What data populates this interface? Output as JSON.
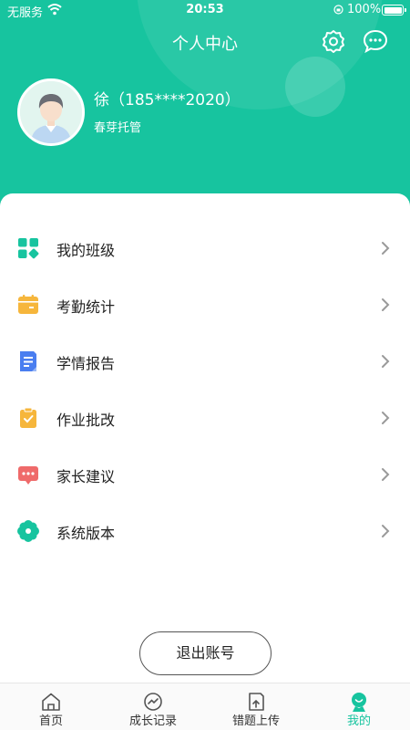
{
  "status_bar": {
    "carrier": "无服务",
    "time": "20:53",
    "battery": "100%"
  },
  "header": {
    "title": "个人中心",
    "settings_icon": "gear-icon",
    "message_icon": "chat-bubble-icon"
  },
  "user": {
    "name": "徐（185****2020）",
    "org": "春芽托管"
  },
  "menu": [
    {
      "label": "我的班级",
      "icon": "grid-icon",
      "color": "#17c49f"
    },
    {
      "label": "考勤统计",
      "icon": "calendar-icon",
      "color": "#f6b63c"
    },
    {
      "label": "学情报告",
      "icon": "report-icon",
      "color": "#4a7ef0"
    },
    {
      "label": "作业批改",
      "icon": "clipboard-check-icon",
      "color": "#f6b63c"
    },
    {
      "label": "家长建议",
      "icon": "comment-icon",
      "color": "#ef6a6a"
    },
    {
      "label": "系统版本",
      "icon": "flower-icon",
      "color": "#17c49f"
    }
  ],
  "logout_label": "退出账号",
  "tabs": [
    {
      "label": "首页",
      "icon": "home-icon",
      "active": false
    },
    {
      "label": "成长记录",
      "icon": "growth-icon",
      "active": false
    },
    {
      "label": "错题上传",
      "icon": "upload-note-icon",
      "active": false
    },
    {
      "label": "我的",
      "icon": "profile-icon",
      "active": true
    }
  ],
  "colors": {
    "brand": "#17c49f",
    "text": "#222222",
    "chevron": "#9a9a9a"
  }
}
